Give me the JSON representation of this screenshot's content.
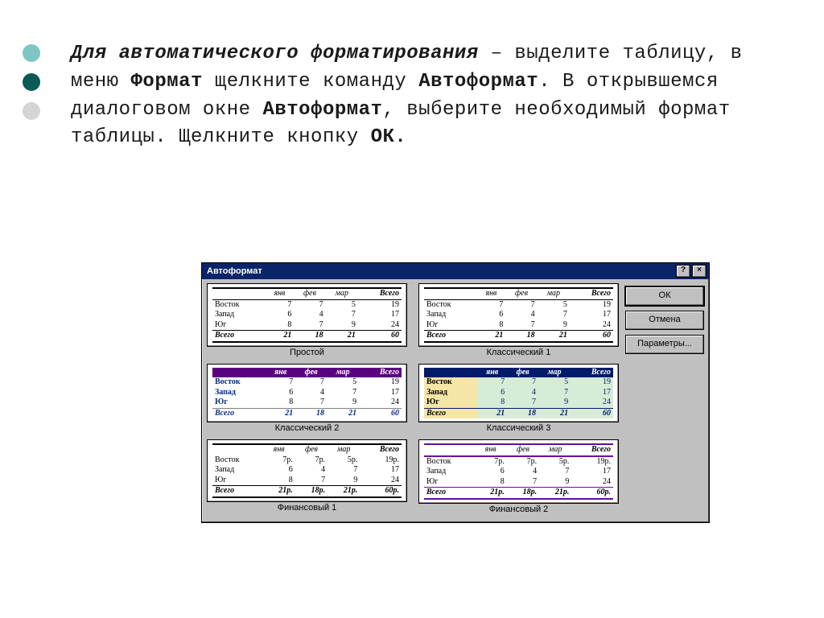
{
  "bullets": {
    "c1": "#7fc5c5",
    "c2": "#0a5a56",
    "c3": "#d5d5d5"
  },
  "paragraph": {
    "t1": "Для автоматического форматирования",
    "t2": " – выделите таблицу, в меню ",
    "t3": "Формат",
    "t4": " щелкните команду ",
    "t5": "Автоформат",
    "t6": ". В открывшемся диалоговом окне ",
    "t7": "Автоформат",
    "t8": ", выберите необходимый формат таблицы. Щелкните кнопку ",
    "t9": "ОК.",
    "t10": ""
  },
  "dialog": {
    "title": "Автоформат",
    "help": "?",
    "close": "×",
    "buttons": {
      "ok": "ОК",
      "cancel": "Отмена",
      "params": "Параметры..."
    },
    "columns": {
      "c0": "",
      "c1": "янв",
      "c2": "фев",
      "c3": "мар",
      "c4": "Всего"
    },
    "rows": {
      "r1": "Восток",
      "r2": "Запад",
      "r3": "Юг",
      "r4": "Всего"
    },
    "data": {
      "r1": {
        "c1": "7",
        "c2": "7",
        "c3": "5",
        "c4": "19"
      },
      "r2": {
        "c1": "6",
        "c2": "4",
        "c3": "7",
        "c4": "17"
      },
      "r3": {
        "c1": "8",
        "c2": "7",
        "c3": "9",
        "c4": "24"
      },
      "r4": {
        "c1": "21",
        "c2": "18",
        "c3": "21",
        "c4": "60"
      }
    },
    "data_fin": {
      "r1": {
        "c1": "7р.",
        "c2": "7р.",
        "c3": "5р.",
        "c4": "19р."
      },
      "r2": {
        "c1": "6",
        "c2": "4",
        "c3": "7",
        "c4": "17"
      },
      "r3": {
        "c1": "8",
        "c2": "7",
        "c3": "9",
        "c4": "24"
      },
      "r4": {
        "c1": "21р.",
        "c2": "18р.",
        "c3": "21р.",
        "c4": "60р."
      }
    },
    "captions": {
      "simple": "Простой",
      "classic1": "Классический 1",
      "classic2": "Классический 2",
      "classic3": "Классический 3",
      "fin1": "Финансовый 1",
      "fin2": "Финансовый 2"
    }
  }
}
